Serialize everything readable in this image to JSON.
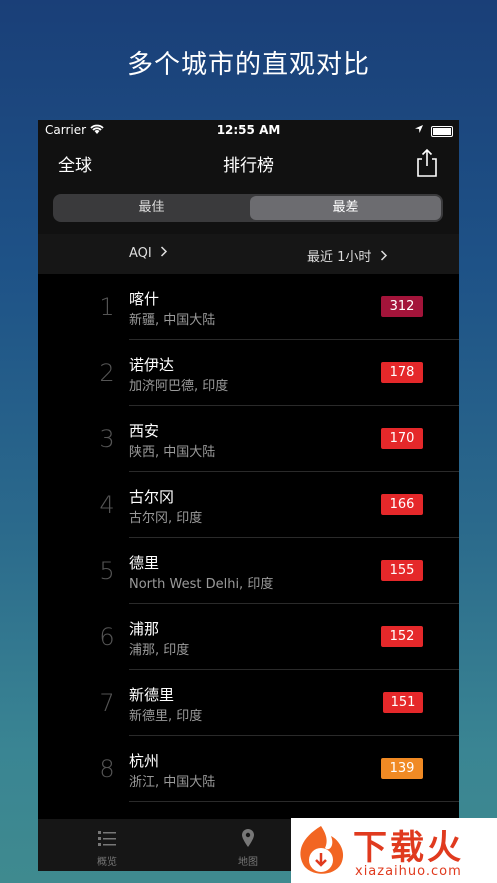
{
  "headline": "多个城市的直观对比",
  "status": {
    "carrier": "Carrier",
    "time": "12:55 AM"
  },
  "nav": {
    "left": "全球",
    "title": "排行榜"
  },
  "segment": {
    "best": "最佳",
    "worst": "最差",
    "selected": "最差"
  },
  "filters": {
    "metric": "AQI",
    "period": "最近 1小时"
  },
  "rows": [
    {
      "rank": "1",
      "city": "喀什",
      "region": "新疆, 中国大陆",
      "aqi": "312",
      "color": "#a3143a"
    },
    {
      "rank": "2",
      "city": "诺伊达",
      "region": "加济阿巴德, 印度",
      "aqi": "178",
      "color": "#e5282a"
    },
    {
      "rank": "3",
      "city": "西安",
      "region": "陕西, 中国大陆",
      "aqi": "170",
      "color": "#e5282a"
    },
    {
      "rank": "4",
      "city": "古尔冈",
      "region": "古尔冈, 印度",
      "aqi": "166",
      "color": "#e5282a"
    },
    {
      "rank": "5",
      "city": "德里",
      "region": "North West Delhi, 印度",
      "aqi": "155",
      "color": "#e5282a"
    },
    {
      "rank": "6",
      "city": "浦那",
      "region": "浦那, 印度",
      "aqi": "152",
      "color": "#e5282a"
    },
    {
      "rank": "7",
      "city": "新德里",
      "region": "新德里, 印度",
      "aqi": "151",
      "color": "#e5282a"
    },
    {
      "rank": "8",
      "city": "杭州",
      "region": "浙江, 中国大陆",
      "aqi": "139",
      "color": "#f08a24"
    }
  ],
  "tabs": [
    {
      "label": "概览"
    },
    {
      "label": "地图"
    }
  ],
  "watermark": {
    "text": "下载火",
    "url": "xiazaihuo.com"
  }
}
